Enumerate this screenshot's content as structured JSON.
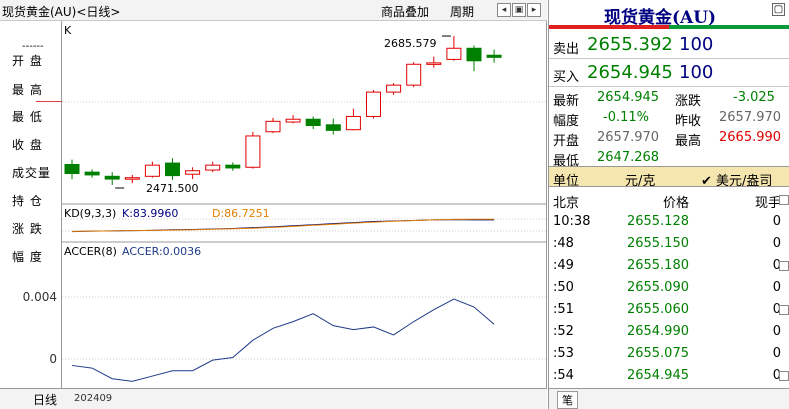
{
  "titlebar": {
    "title": "现货黄金(AU)<日线>",
    "menu_overlay": "商品叠加",
    "menu_period": "周期"
  },
  "left_labels": {
    "dash": "------",
    "items": [
      "开  盘",
      "最  高",
      "最  低",
      "收  盘",
      "成交量",
      "持  仓",
      "涨  跌",
      "幅  度"
    ]
  },
  "y_axis_ticks": [
    "0.004",
    "0"
  ],
  "bottom": {
    "period": "日线",
    "date": "202409"
  },
  "panels": {
    "main_label": "K",
    "high_annotation": "2685.579",
    "low_annotation": "2471.500",
    "kd_label": "KD(9,3,3)",
    "kd_k": "K:83.9960",
    "kd_d": "D:86.7251",
    "accer_label": "ACCER(8)",
    "accer_value": "ACCER:0.0036"
  },
  "colors": {
    "up": "#e00000",
    "down": "#008000",
    "kd_k": "#000080",
    "kd_d": "#e08000",
    "accer": "#1f3a8a"
  },
  "chart_data": [
    {
      "type": "candlestick",
      "title": "",
      "candles": [
        {
          "open": 2501,
          "close": 2488,
          "high": 2508,
          "low": 2480
        },
        {
          "open": 2490,
          "close": 2486,
          "high": 2494,
          "low": 2482
        },
        {
          "open": 2484,
          "close": 2480,
          "high": 2490,
          "low": 2471.5
        },
        {
          "open": 2480,
          "close": 2482,
          "high": 2486,
          "low": 2474
        },
        {
          "open": 2484,
          "close": 2500,
          "high": 2505,
          "low": 2482
        },
        {
          "open": 2503,
          "close": 2485,
          "high": 2510,
          "low": 2479
        },
        {
          "open": 2487,
          "close": 2492,
          "high": 2497,
          "low": 2480
        },
        {
          "open": 2493,
          "close": 2500,
          "high": 2505,
          "low": 2490
        },
        {
          "open": 2500,
          "close": 2496,
          "high": 2504,
          "low": 2492
        },
        {
          "open": 2497,
          "close": 2542,
          "high": 2548,
          "low": 2495
        },
        {
          "open": 2548,
          "close": 2563,
          "high": 2568,
          "low": 2546
        },
        {
          "open": 2562,
          "close": 2566,
          "high": 2572,
          "low": 2560
        },
        {
          "open": 2566,
          "close": 2557,
          "high": 2570,
          "low": 2552
        },
        {
          "open": 2558,
          "close": 2550,
          "high": 2567,
          "low": 2544
        },
        {
          "open": 2551,
          "close": 2570,
          "high": 2581,
          "low": 2550
        },
        {
          "open": 2570,
          "close": 2605,
          "high": 2608,
          "low": 2567
        },
        {
          "open": 2605,
          "close": 2615,
          "high": 2618,
          "low": 2601
        },
        {
          "open": 2615,
          "close": 2645,
          "high": 2648,
          "low": 2612
        },
        {
          "open": 2647,
          "close": 2647,
          "high": 2656,
          "low": 2640
        },
        {
          "open": 2652,
          "close": 2668,
          "high": 2685.579,
          "low": 2650
        },
        {
          "open": 2668,
          "close": 2650,
          "high": 2672,
          "low": 2635
        },
        {
          "open": 2658,
          "close": 2654.945,
          "high": 2665.99,
          "low": 2647.268
        }
      ],
      "annotations": [
        "2685.579",
        "2471.500"
      ]
    },
    {
      "type": "line",
      "title": "KD(9,3,3)",
      "series": [
        {
          "name": "K",
          "values": [
            40,
            42,
            43,
            44,
            45,
            47,
            48,
            50,
            52,
            55,
            58,
            62,
            66,
            70,
            74,
            78,
            80,
            82,
            84,
            85,
            84,
            83.996
          ]
        },
        {
          "name": "D",
          "values": [
            41,
            42,
            43,
            44,
            45,
            46,
            47,
            49,
            51,
            53,
            56,
            60,
            64,
            68,
            72,
            76,
            79,
            82,
            84,
            86,
            86.5,
            86.7251
          ]
        }
      ]
    },
    {
      "type": "line",
      "title": "ACCER(8)",
      "ylim": [
        -0.0012,
        0.0098
      ],
      "y_ticks": [
        0.004,
        0
      ],
      "series": [
        {
          "name": "ACCER",
          "values": [
            0.0005,
            0.0003,
            -0.0005,
            -0.0007,
            -0.0003,
            0.0001,
            0.0001,
            0.0009,
            0.0011,
            0.0024,
            0.0033,
            0.0038,
            0.0044,
            0.0035,
            0.0032,
            0.0034,
            0.0028,
            0.0038,
            0.0047,
            0.0055,
            0.0049,
            0.0036
          ]
        }
      ]
    }
  ],
  "quote": {
    "name": "现货黄金(AU)",
    "sell_label": "卖出",
    "sell_price": "2655.392",
    "sell_qty": "100",
    "buy_label": "买入",
    "buy_price": "2654.945",
    "buy_qty": "100",
    "stats": {
      "latest_label": "最新",
      "latest": "2654.945",
      "change_label": "涨跌",
      "change": "-3.025",
      "amp_label": "幅度",
      "amp": "-0.11%",
      "prev_label": "昨收",
      "prev": "2657.970",
      "open_label": "开盘",
      "open": "2657.970",
      "high_label": "最高",
      "high": "2665.990",
      "low_label": "最低",
      "low": "2647.268"
    },
    "unit_label": "单位",
    "unit_value": "元/克",
    "unit_option": "✔ 美元/盎司",
    "ticks_header": {
      "time": "北京",
      "price": "价格",
      "vol": "现手"
    },
    "ticks": [
      {
        "time": "10:38",
        "price": "2655.128",
        "vol": "0"
      },
      {
        "time": ":48",
        "price": "2655.150",
        "vol": "0"
      },
      {
        "time": ":49",
        "price": "2655.180",
        "vol": "0"
      },
      {
        "time": ":50",
        "price": "2655.090",
        "vol": "0"
      },
      {
        "time": ":51",
        "price": "2655.060",
        "vol": "0"
      },
      {
        "time": ":52",
        "price": "2654.990",
        "vol": "0"
      },
      {
        "time": ":53",
        "price": "2655.075",
        "vol": "0"
      },
      {
        "time": ":54",
        "price": "2654.945",
        "vol": "0"
      }
    ],
    "footer_tab": "笔"
  }
}
